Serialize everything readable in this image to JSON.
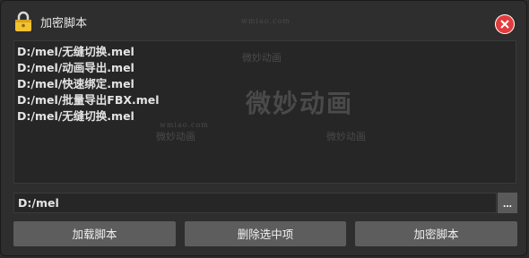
{
  "window": {
    "title": "加密脚本",
    "icons": {
      "lock": "lock-icon",
      "close": "close-icon"
    }
  },
  "script_list": {
    "items": [
      "D:/mel/无缝切换.mel",
      "D:/mel/动画导出.mel",
      "D:/mel/快速绑定.mel",
      "D:/mel/批量导出FBX.mel",
      "D:/mel/无缝切换.mel"
    ]
  },
  "watermark": {
    "brand_cn": "微妙动画",
    "brand_url": "wmiao.com",
    "brand_url_tiny": "wmiao.com"
  },
  "path": {
    "value": "D:/mel",
    "browse_label": "..."
  },
  "buttons": {
    "load": "加载脚本",
    "delete": "删除选中项",
    "encrypt": "加密脚本"
  },
  "colors": {
    "background": "#2e2e2e",
    "button": "#5d5d5d",
    "close": "#e23b3b",
    "lock": "#f2c230"
  }
}
